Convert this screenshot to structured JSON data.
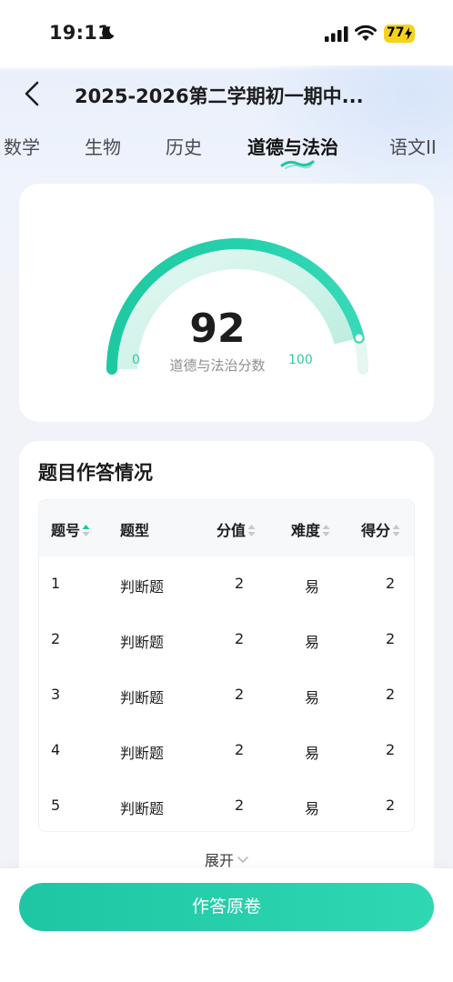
{
  "status_bar": {
    "time": "19:11",
    "battery": "77",
    "icons": [
      "moon-icon",
      "signal-icon",
      "wifi-icon",
      "battery-icon"
    ]
  },
  "nav": {
    "title": "2025-2026第二学期初一期中...",
    "back_icon": "chevron-left-icon"
  },
  "tabs": [
    {
      "label": "数学",
      "active": false
    },
    {
      "label": "生物",
      "active": false
    },
    {
      "label": "历史",
      "active": false
    },
    {
      "label": "道德与法治",
      "active": true
    },
    {
      "label": "语文II",
      "active": false
    }
  ],
  "score_card": {
    "score": "92",
    "subject_label": "道德与法治分数",
    "min": "0",
    "max": "100",
    "gauge_fraction": 0.92,
    "accent_color": "#1fc6a4"
  },
  "questions": {
    "title": "题目作答情况",
    "columns": [
      "题号",
      "题型",
      "分值",
      "难度",
      "得分"
    ],
    "rows": [
      [
        "1",
        "判断题",
        "2",
        "易",
        "2"
      ],
      [
        "2",
        "判断题",
        "2",
        "易",
        "2"
      ],
      [
        "3",
        "判断题",
        "2",
        "易",
        "2"
      ],
      [
        "4",
        "判断题",
        "2",
        "易",
        "2"
      ],
      [
        "5",
        "判断题",
        "2",
        "易",
        "2"
      ]
    ],
    "expand_label": "展开"
  },
  "bottom": {
    "button_label": "作答原卷"
  }
}
